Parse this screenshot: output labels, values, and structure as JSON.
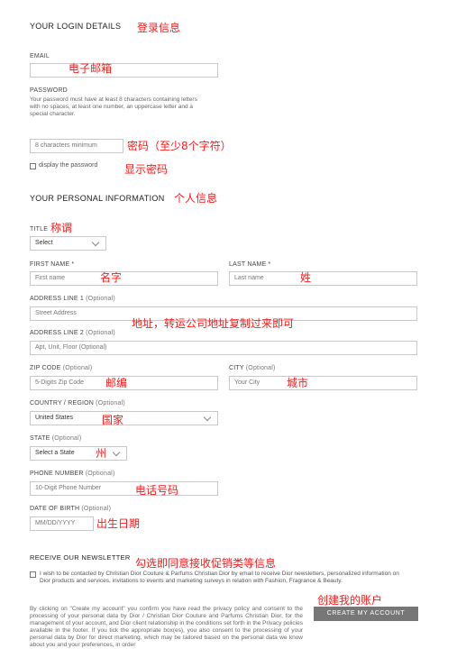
{
  "login": {
    "section_title": "YOUR LOGIN DETAILS",
    "section_note": "登录信息",
    "email_label": "EMAIL",
    "email_note": "电子邮箱",
    "password_label": "PASSWORD",
    "password_help": "Your password must have at least 8 characters containing letters with no spaces, at least one number, an uppercase letter and a special character.",
    "password_placeholder": "8 characters minimum",
    "password_note": "密码（至少8个字符）",
    "show_password_label": "display the password",
    "show_password_note": "显示密码"
  },
  "personal": {
    "section_title": "YOUR PERSONAL INFORMATION",
    "section_note": "个人信息",
    "title_label": "TITLE",
    "title_note": "称谓",
    "title_value": "Select",
    "first_name_label": "FIRST NAME *",
    "first_name_placeholder": "First name",
    "first_name_note": "名字",
    "last_name_label": "LAST NAME *",
    "last_name_placeholder": "Last name",
    "last_name_note": "姓",
    "address1_label": "ADDRESS LINE 1",
    "address1_optional": "(Optional)",
    "address1_placeholder": "Street Address",
    "address_note": "地址，转运公司地址复制过来即可",
    "address2_label": "ADDRESS LINE 2",
    "address2_optional": "(Optional)",
    "address2_placeholder": "Apt, Unit, Floor (Optional)",
    "zip_label": "ZIP CODE",
    "zip_optional": "(Optional)",
    "zip_placeholder": "5-Digits Zip Code",
    "zip_note": "邮编",
    "city_label": "CITY",
    "city_optional": "(Optional)",
    "city_placeholder": "Your City",
    "city_note": "城市",
    "country_label": "COUNTRY / REGION",
    "country_optional": "(Optional)",
    "country_value": "United States",
    "country_note": "国家",
    "state_label": "STATE",
    "state_optional": "(Optional)",
    "state_value": "Select a State",
    "state_note": "州",
    "phone_label": "PHONE NUMBER",
    "phone_optional": "(Optional)",
    "phone_placeholder": "10-Digit Phone Number",
    "phone_note": "电话号码",
    "dob_label": "DATE OF BIRTH",
    "dob_optional": "(Optional)",
    "dob_placeholder": "MM/DD/YYYY",
    "dob_note": "出生日期"
  },
  "newsletter": {
    "section_title": "RECEIVE OUR NEWSLETTER",
    "section_note": "勾选即同意接收促销类等信息",
    "consent_text": "I wish to be contacted by Christian Dior Couture & Parfums Christian Dior by email to receive Dior newsletters, personalized information on Dior products and services, invitations to events and marketing surveys in relation with Fashion, Fragrance & Beauty.",
    "disclaimer": "By clicking on \"Create my account\" you confirm you have read the privacy policy and consent to the processing of your personal data by Dior / Christian Dior Couture and Parfums Christian Dior, for the management of your account, and Dior client relationship in the conditions set forth in the Privacy policies available in the footer. If you tick the appropriate box(es), you also consent to the processing of your personal data by Dior for direct marketing, which may be tailored based on the personal data we know about you and your preferences, in order",
    "create_button": "CREATE MY ACCOUNT",
    "create_note": "创建我的账户"
  },
  "icons": {
    "dropdown": "chevron-down-icon",
    "checkbox": "checkbox-icon"
  },
  "colors": {
    "annotation": "#ff1a1a",
    "button": "#777777",
    "border": "#c9c9c9"
  }
}
